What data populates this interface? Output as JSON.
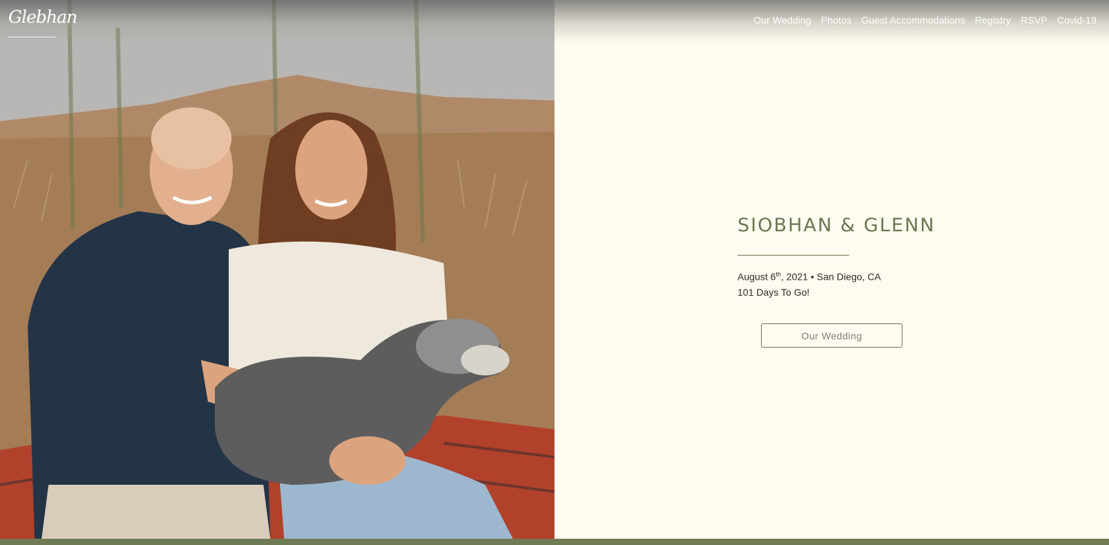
{
  "logo": {
    "text": "Glebhan"
  },
  "nav": {
    "items": [
      {
        "label": "Our Wedding"
      },
      {
        "label": "Photos"
      },
      {
        "label": "Guest Accommodations"
      },
      {
        "label": "Registry"
      },
      {
        "label": "RSVP"
      },
      {
        "label": "Covid-19"
      }
    ]
  },
  "hero": {
    "names": "SIOBHAN & GLENN",
    "date_prefix": "August 6",
    "date_suffix": "th",
    "date_rest": ", 2021 • San Diego, CA",
    "countdown": "101 Days To Go!",
    "button_label": "Our Wedding"
  },
  "colors": {
    "accent": "#6b7751",
    "background": "#fefbf0",
    "bottom_bar": "#6e7b55"
  }
}
